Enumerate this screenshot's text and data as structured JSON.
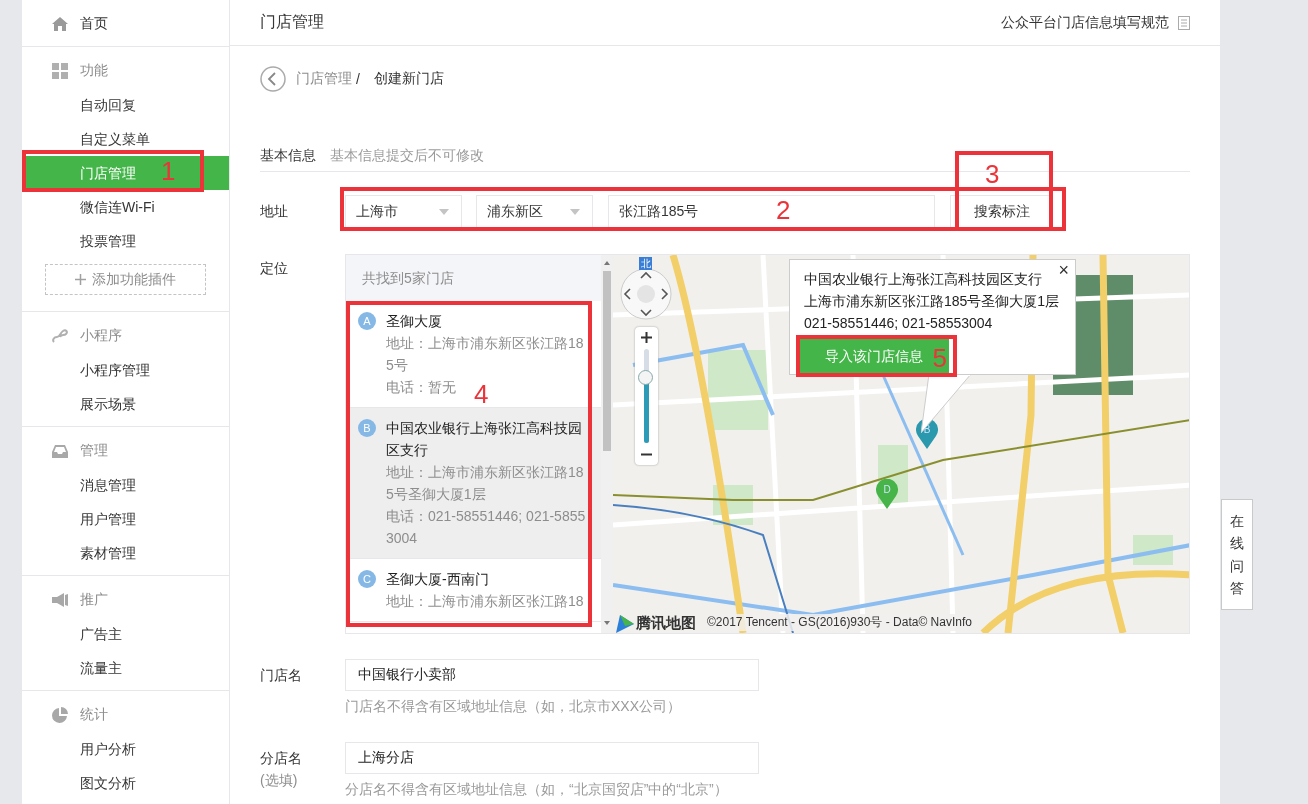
{
  "sidebar": {
    "sections": [
      {
        "kind": "link",
        "title": "首页"
      },
      {
        "kind": "group",
        "title": "功能",
        "items": [
          {
            "label": "自动回复",
            "selected": false
          },
          {
            "label": "自定义菜单",
            "selected": false
          },
          {
            "label": "门店管理",
            "selected": true,
            "annotation": "1"
          },
          {
            "label": "微信连Wi-Fi",
            "selected": false
          },
          {
            "label": "投票管理",
            "selected": false
          }
        ],
        "add_button": "添加功能插件"
      },
      {
        "kind": "group",
        "title": "小程序",
        "items": [
          {
            "label": "小程序管理",
            "selected": false
          },
          {
            "label": "展示场景",
            "selected": false
          }
        ]
      },
      {
        "kind": "group",
        "title": "管理",
        "items": [
          {
            "label": "消息管理",
            "selected": false
          },
          {
            "label": "用户管理",
            "selected": false
          },
          {
            "label": "素材管理",
            "selected": false
          }
        ]
      },
      {
        "kind": "group",
        "title": "推广",
        "items": [
          {
            "label": "广告主",
            "selected": false
          },
          {
            "label": "流量主",
            "selected": false
          }
        ]
      },
      {
        "kind": "group",
        "title": "统计",
        "items": [
          {
            "label": "用户分析",
            "selected": false
          },
          {
            "label": "图文分析",
            "selected": false
          }
        ]
      }
    ]
  },
  "header": {
    "title": "门店管理",
    "guide_link": "公众平台门店信息填写规范"
  },
  "breadcrumb": {
    "parent": "门店管理",
    "separator": "/",
    "current": "创建新门店"
  },
  "section": {
    "title": "基本信息",
    "note": "基本信息提交后不可修改"
  },
  "address": {
    "label": "地址",
    "province": "上海市",
    "district": "浦东新区",
    "street": "张江路185号",
    "annotation": "2",
    "search_button": "搜索标注",
    "search_annotation": "3"
  },
  "location": {
    "label": "定位",
    "results": {
      "summary": "共找到5家门店",
      "annotation": "4",
      "items": [
        {
          "badge": "A",
          "name": "圣御大厦",
          "address": "地址：上海市浦东新区张江路185号",
          "phone": "电话：暂无",
          "selected": false
        },
        {
          "badge": "B",
          "name": "中国农业银行上海张江高科技园区支行",
          "address": "地址：上海市浦东新区张江路185号圣御大厦1层",
          "phone": "电话：021-58551446; 021-58553004",
          "selected": true
        },
        {
          "badge": "C",
          "name": "圣御大厦-西南门",
          "address": "地址：上海市浦东新区张江路18",
          "selected": false
        }
      ]
    },
    "map": {
      "compass": "北",
      "zoom": {
        "level": 0.7
      },
      "pins": [
        {
          "label": "B",
          "selected": true
        },
        {
          "label": "D",
          "selected": false
        }
      ],
      "popup": {
        "close": "×",
        "name": "中国农业银行上海张江高科技园区支行",
        "address": "上海市浦东新区张江路185号圣御大厦1层",
        "phone": "021-58551446; 021-58553004",
        "import_button": "导入该门店信息",
        "annotation": "5"
      },
      "logo": "腾讯地图",
      "copyright": "©2017 Tencent - GS(2016)930号 - Data© NavInfo"
    }
  },
  "store_name": {
    "label": "门店名",
    "value": "中国银行小卖部",
    "hint": "门店名不得含有区域地址信息（如，北京市XXX公司）"
  },
  "branch_name": {
    "label": "分店名",
    "optional": "(选填)",
    "value": "上海分店",
    "hint": "分店名不得含有区域地址信息（如，“北京国贸店”中的“北京”）"
  },
  "side_tab": "在线问答"
}
